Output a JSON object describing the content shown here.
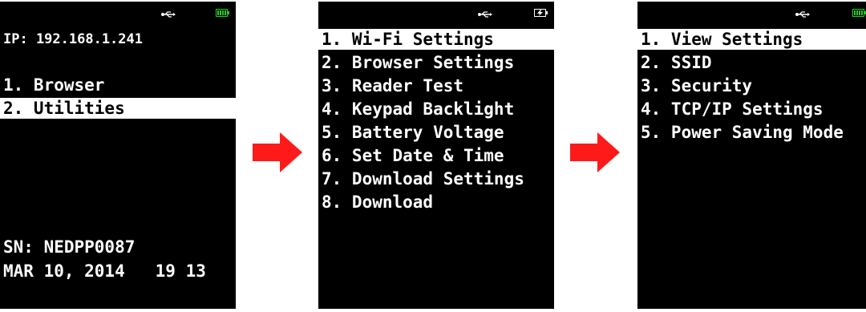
{
  "colors": {
    "screen_bg": "#000000",
    "text": "#ffffff",
    "selection_bg": "#ffffff",
    "selection_text": "#000000",
    "arrow": "#ff1a1a",
    "battery": "#22cc22"
  },
  "screen1": {
    "status_icons": [
      "usb-icon",
      "battery-full-icon"
    ],
    "ip_line": "IP: 192.168.1.241",
    "items": [
      "1. Browser",
      "2. Utilities"
    ],
    "selected_index": 1,
    "serial_line": "SN: NEDPP0087",
    "datetime_line": "MAR 10, 2014   19 13"
  },
  "screen2": {
    "status_icons": [
      "usb-icon",
      "battery-charging-icon"
    ],
    "items": [
      "1. Wi-Fi Settings",
      "2. Browser Settings",
      "3. Reader Test",
      "4. Keypad Backlight",
      "5. Battery Voltage",
      "6. Set Date & Time",
      "7. Download Settings",
      "8. Download"
    ],
    "selected_index": 0
  },
  "screen3": {
    "status_icons": [
      "usb-icon",
      "battery-full-icon"
    ],
    "items": [
      "1. View Settings",
      "2. SSID",
      "3. Security",
      "4. TCP/IP Settings",
      "5. Power Saving Mode"
    ],
    "selected_index": 0
  },
  "arrows": [
    "right-arrow-icon",
    "right-arrow-icon"
  ]
}
